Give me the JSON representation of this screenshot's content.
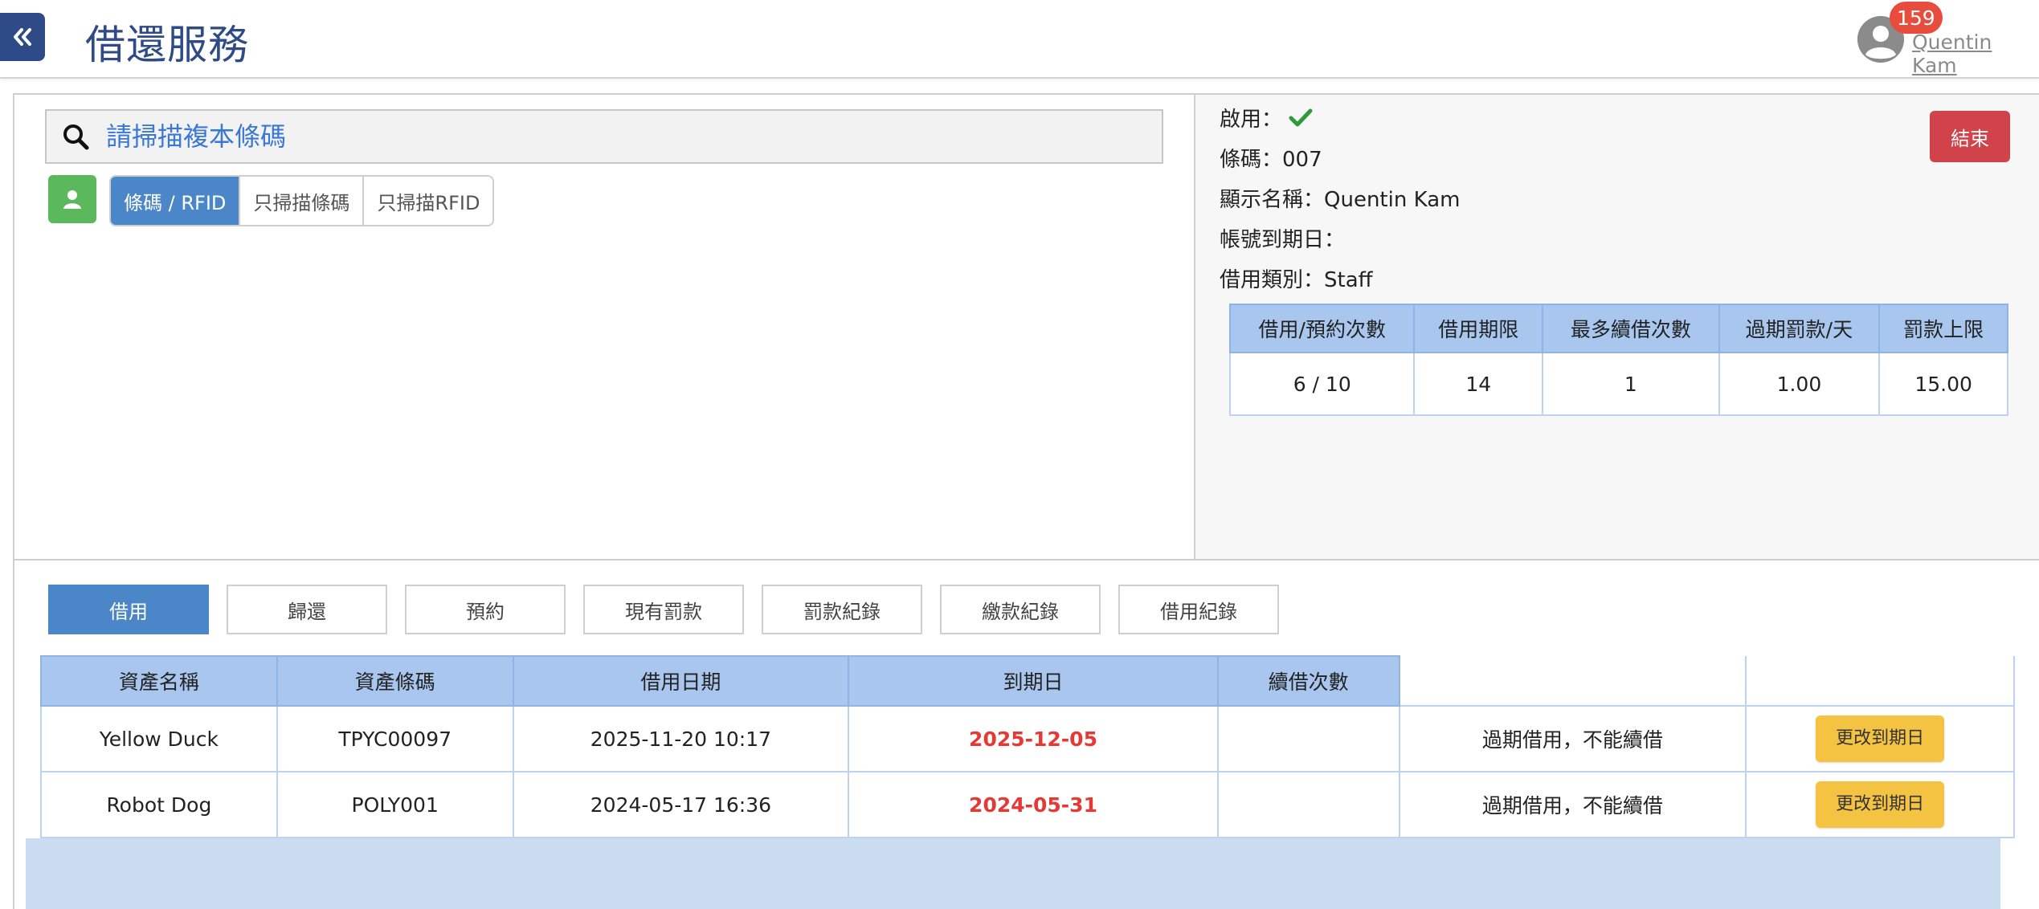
{
  "header": {
    "title": "借還服務",
    "notification_count": "159",
    "user_name": "Quentin Kam"
  },
  "search": {
    "placeholder": "請掃描複本條碼",
    "value": ""
  },
  "scan_modes": [
    {
      "label": "條碼 / RFID",
      "active": true
    },
    {
      "label": "只掃描條碼",
      "active": false
    },
    {
      "label": "只掃描RFID",
      "active": false
    }
  ],
  "patron": {
    "enabled_label": "啟用：",
    "enabled": true,
    "barcode_label": "條碼：",
    "barcode": "007",
    "display_name_label": "顯示名稱：",
    "display_name": "Quentin Kam",
    "expiry_label": "帳號到期日：",
    "expiry": "",
    "category_label": "借用類別：",
    "category": "Staff",
    "end_button": "結束"
  },
  "quota_table": {
    "headers": [
      "借用/預約次數",
      "借用期限",
      "最多續借次數",
      "過期罰款/天",
      "罰款上限"
    ],
    "row": [
      "6 / 10",
      "14",
      "1",
      "1.00",
      "15.00"
    ]
  },
  "tabs": [
    {
      "label": "借用",
      "active": true
    },
    {
      "label": "歸還",
      "active": false
    },
    {
      "label": "預約",
      "active": false
    },
    {
      "label": "現有罰款",
      "active": false
    },
    {
      "label": "罰款紀錄",
      "active": false
    },
    {
      "label": "繳款紀錄",
      "active": false
    },
    {
      "label": "借用紀錄",
      "active": false
    }
  ],
  "loans": {
    "headers": [
      "資產名稱",
      "資產條碼",
      "借用日期",
      "到期日",
      "續借次數"
    ],
    "rows": [
      {
        "name": "Yellow Duck",
        "barcode": "TPYC00097",
        "loan_date": "2025-11-20 10:17",
        "due_date": "2025-12-05",
        "renewals": "",
        "status": "過期借用，不能續借",
        "action": "更改到期日"
      },
      {
        "name": "Robot Dog",
        "barcode": "POLY001",
        "loan_date": "2024-05-17 16:36",
        "due_date": "2024-05-31",
        "renewals": "",
        "status": "過期借用，不能續借",
        "action": "更改到期日"
      }
    ]
  },
  "colors": {
    "brand": "#2f4b87",
    "active_tab": "#4a86c8",
    "table_header": "#a8c6ee",
    "due_date": "#e53935",
    "end_button": "#d0434a",
    "change_button": "#f5c342",
    "user_button": "#5cb85c"
  },
  "icons": {
    "back": "double-chevron-left-icon",
    "search": "search-icon",
    "user": "user-icon",
    "check": "check-icon",
    "avatar": "avatar-icon"
  }
}
